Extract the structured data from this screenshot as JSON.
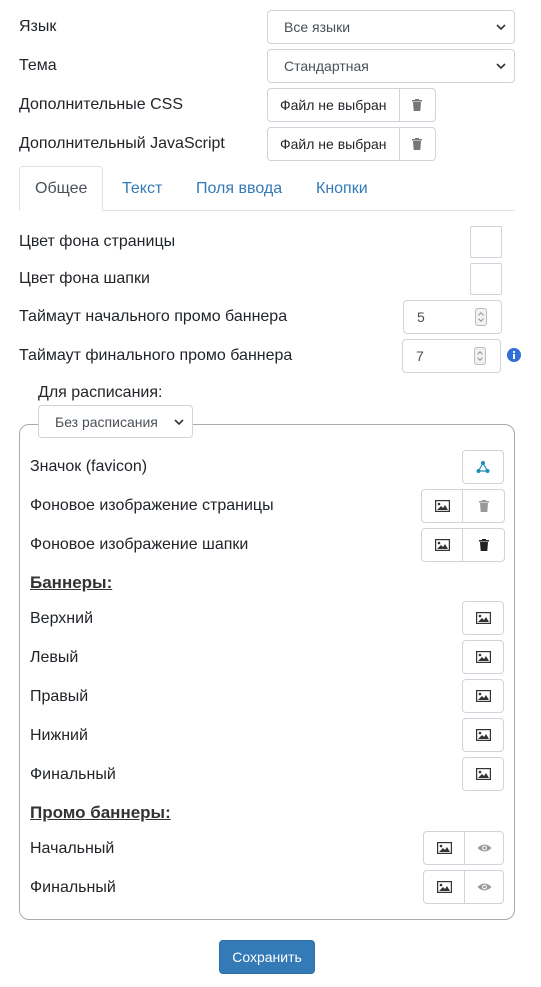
{
  "settings": {
    "language_label": "Язык",
    "language_value": "Все языки",
    "theme_label": "Тема",
    "theme_value": "Стандартная",
    "css_label": "Дополнительные CSS",
    "css_file": "Файл не выбран",
    "js_label": "Дополнительный JavaScript",
    "js_file": "Файл не выбран"
  },
  "tabs": [
    {
      "label": "Общее",
      "active": true
    },
    {
      "label": "Текст",
      "active": false
    },
    {
      "label": "Поля ввода",
      "active": false
    },
    {
      "label": "Кнопки",
      "active": false
    }
  ],
  "general": {
    "page_bg_label": "Цвет фона страницы",
    "header_bg_label": "Цвет фона шапки",
    "start_promo_label": "Таймаут начального промо баннера",
    "start_promo_value": "5",
    "final_promo_label": "Таймаут финального промо баннера",
    "final_promo_value": "7"
  },
  "schedule": {
    "label": "Для расписания:",
    "value": "Без расписания"
  },
  "media": {
    "favicon_label": "Значок (favicon)",
    "page_bg_image_label": "Фоновое изображение страницы",
    "header_bg_image_label": "Фоновое изображение шапки",
    "banners_title": "Баннеры:",
    "banners": [
      "Верхний",
      "Левый",
      "Правый",
      "Нижний",
      "Финальный"
    ],
    "promo_title": "Промо баннеры:",
    "promo": [
      "Начальный",
      "Финальный"
    ]
  },
  "actions": {
    "save_label": "Сохранить"
  },
  "colors": {
    "primary": "#337ab7",
    "link": "#337ab7",
    "info_icon": "#2f6fd6",
    "favicon_icon": "#1f8fb8"
  }
}
